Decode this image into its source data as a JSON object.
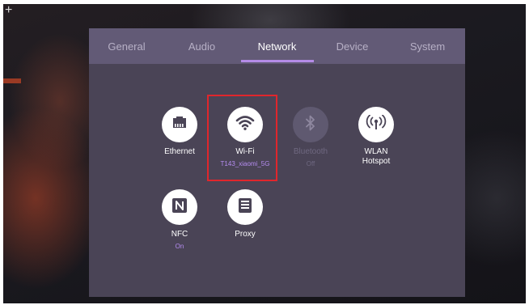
{
  "tabs": [
    {
      "label": "General"
    },
    {
      "label": "Audio"
    },
    {
      "label": "Network"
    },
    {
      "label": "Device"
    },
    {
      "label": "System"
    }
  ],
  "active_tab": "Network",
  "network_items": [
    {
      "label": "Ethernet",
      "sub": "",
      "icon": "ethernet-icon",
      "enabled": true
    },
    {
      "label": "Wi-Fi",
      "sub": "T143_xiaomi_5G",
      "icon": "wifi-icon",
      "enabled": true,
      "highlighted": true
    },
    {
      "label": "Bluetooth",
      "sub": "Off",
      "icon": "bluetooth-icon",
      "enabled": false
    },
    {
      "label": "WLAN\nHotspot",
      "sub": "",
      "icon": "hotspot-icon",
      "enabled": true
    },
    {
      "label": "NFC",
      "sub": "On",
      "icon": "nfc-icon",
      "enabled": true
    },
    {
      "label": "Proxy",
      "sub": "",
      "icon": "proxy-icon",
      "enabled": true
    }
  ],
  "colors": {
    "panel_bg": "#4a4456",
    "tab_bar_bg": "#625a76",
    "accent": "#b48be6",
    "highlight_border": "#e0262c"
  }
}
